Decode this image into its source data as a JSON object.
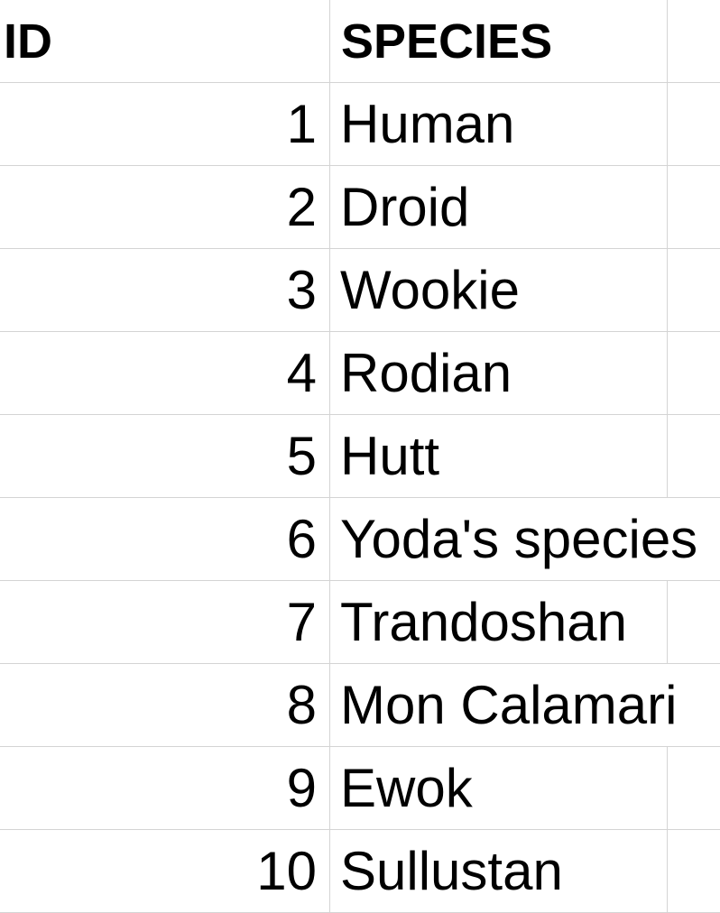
{
  "headers": {
    "id": "ID",
    "species": "SPECIES"
  },
  "rows": [
    {
      "id": "1",
      "species": "Human"
    },
    {
      "id": "2",
      "species": "Droid"
    },
    {
      "id": "3",
      "species": "Wookie"
    },
    {
      "id": "4",
      "species": "Rodian"
    },
    {
      "id": "5",
      "species": "Hutt"
    },
    {
      "id": "6",
      "species": "Yoda's species"
    },
    {
      "id": "7",
      "species": "Trandoshan"
    },
    {
      "id": "8",
      "species": "Mon Calamari"
    },
    {
      "id": "9",
      "species": "Ewok"
    },
    {
      "id": "10",
      "species": "Sullustan"
    }
  ]
}
